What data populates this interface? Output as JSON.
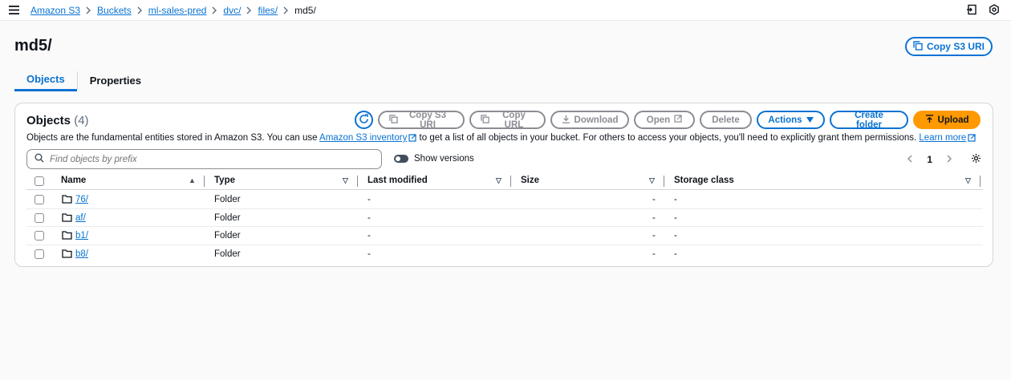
{
  "breadcrumb": {
    "items": [
      "Amazon S3",
      "Buckets",
      "ml-sales-pred",
      "dvc/",
      "files/"
    ],
    "current": "md5/"
  },
  "page": {
    "title": "md5/",
    "copy_uri_label": "Copy S3 URI"
  },
  "tabs": [
    {
      "label": "Objects",
      "active": true
    },
    {
      "label": "Properties",
      "active": false
    }
  ],
  "objects_panel": {
    "title": "Objects",
    "count": "(4)",
    "buttons": {
      "copy_s3_uri": "Copy S3 URI",
      "copy_url": "Copy URL",
      "download": "Download",
      "open": "Open",
      "delete": "Delete",
      "actions": "Actions",
      "create_folder": "Create folder",
      "upload": "Upload"
    },
    "description_pre": "Objects are the fundamental entities stored in Amazon S3. You can use ",
    "inventory_link": "Amazon S3 inventory",
    "description_mid": " to get a list of all objects in your bucket. For others to access your objects, you'll need to explicitly grant them permissions. ",
    "learn_more": "Learn more",
    "search_placeholder": "Find objects by prefix",
    "show_versions": "Show versions",
    "page_number": "1"
  },
  "table": {
    "columns": [
      "Name",
      "Type",
      "Last modified",
      "Size",
      "Storage class"
    ],
    "rows": [
      {
        "name": "76/",
        "type": "Folder",
        "last_modified": "-",
        "size": "-",
        "storage_class": "-"
      },
      {
        "name": "af/",
        "type": "Folder",
        "last_modified": "-",
        "size": "-",
        "storage_class": "-"
      },
      {
        "name": "b1/",
        "type": "Folder",
        "last_modified": "-",
        "size": "-",
        "storage_class": "-"
      },
      {
        "name": "b8/",
        "type": "Folder",
        "last_modified": "-",
        "size": "-",
        "storage_class": "-"
      }
    ]
  },
  "colors": {
    "accent": "#0972d3",
    "upload": "#ff9900",
    "disabled": "#8c8c94"
  }
}
